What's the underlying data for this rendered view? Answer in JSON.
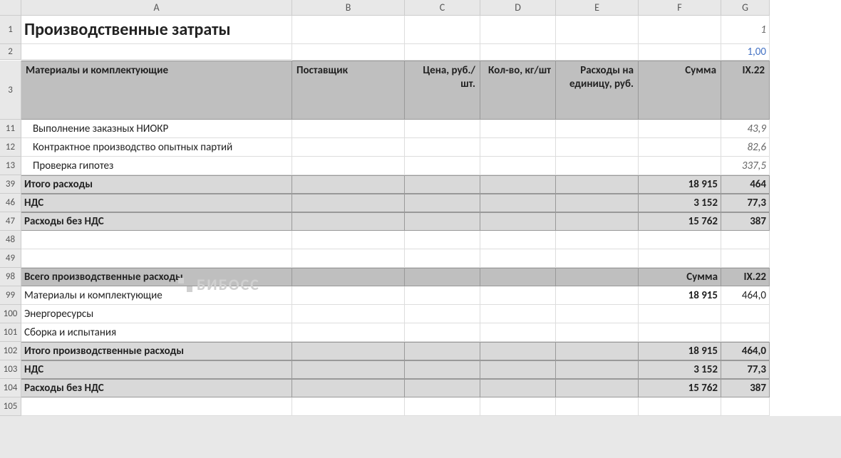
{
  "columns": [
    "A",
    "B",
    "C",
    "D",
    "E",
    "F",
    "G"
  ],
  "row_numbers": [
    "1",
    "2",
    "3",
    "11",
    "12",
    "13",
    "39",
    "46",
    "47",
    "48",
    "49",
    "98",
    "99",
    "100",
    "101",
    "102",
    "103",
    "104",
    "105"
  ],
  "title": "Производственные затраты",
  "r1_g": "1",
  "r2_g": "1,00",
  "headers": {
    "A": "Материалы и комплектующие",
    "B": "Поставщик",
    "C": "Цена, руб./шт.",
    "D": "Кол-во, кг/шт",
    "E": "Расходы на единицу, руб.",
    "F": "Сумма",
    "G": "IX.22"
  },
  "r11": {
    "A": "Выполнение заказных НИОКР",
    "G": "43,9"
  },
  "r12": {
    "A": "Контрактное производство опытных партий",
    "G": "82,6"
  },
  "r13": {
    "A": "Проверка гипотез",
    "G": "337,5"
  },
  "r39": {
    "A": "Итого расходы",
    "F": "18 915",
    "G": "464"
  },
  "r46": {
    "A": "НДС",
    "F": "3 152",
    "G": "77,3"
  },
  "r47": {
    "A": "Расходы без НДС",
    "F": "15 762",
    "G": "387"
  },
  "r98": {
    "A": "Всего производственные расходы",
    "F": "Сумма",
    "G": "IX.22"
  },
  "r99": {
    "A": "Материалы и комплектующие",
    "F": "18 915",
    "G": "464,0"
  },
  "r100": {
    "A": "Энергоресурсы"
  },
  "r101": {
    "A": "Сборка и испытания"
  },
  "r102": {
    "A": "Итого производственные расходы",
    "F": "18 915",
    "G": "464,0"
  },
  "r103": {
    "A": "НДС",
    "F": "3 152",
    "G": "77,3"
  },
  "r104": {
    "A": "Расходы без НДС",
    "F": "15 762",
    "G": "387"
  },
  "watermark": "БИБОСС"
}
